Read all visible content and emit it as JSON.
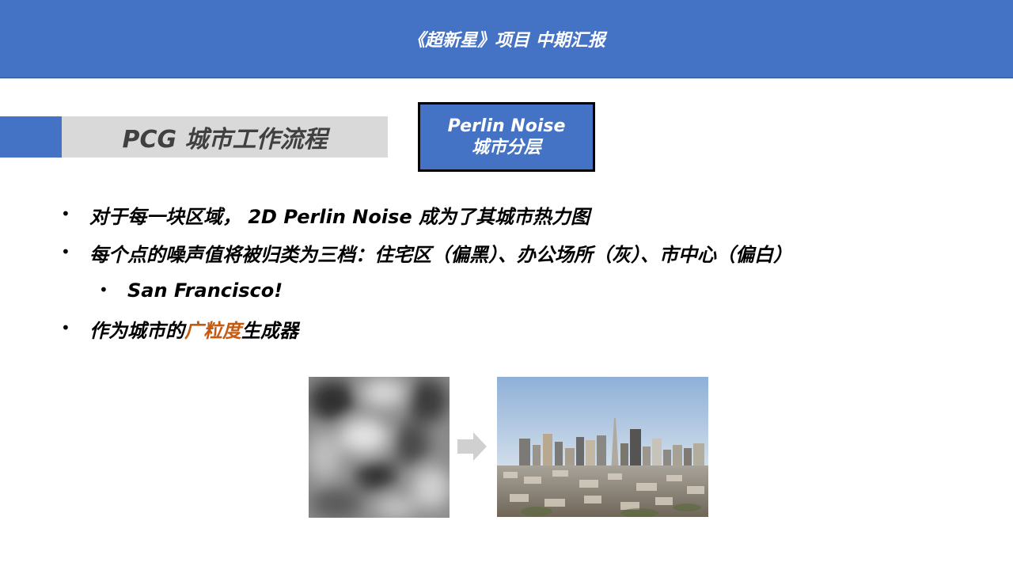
{
  "header": {
    "title": "《超新星》项目 中期汇报"
  },
  "section": {
    "title": "PCG 城市工作流程"
  },
  "badge": {
    "line1": "Perlin Noise",
    "line2": "城市分层"
  },
  "bullets": [
    {
      "text": "对于每一块区域， 2D Perlin Noise 成为了其城市热力图"
    },
    {
      "text": "每个点的噪声值将被归类为三档：住宅区（偏黑）、办公场所（灰）、市中心（偏白）"
    },
    {
      "text": "San Francisco!"
    },
    {
      "prefix": "作为城市的",
      "highlight": "广粒度",
      "suffix": "生成器"
    }
  ],
  "bullet_symbol": "•",
  "colors": {
    "header": "#4472c4",
    "accent": "#4472c4",
    "section_bar": "#d9d9d9",
    "highlight": "#c55a11"
  },
  "images": {
    "noise": "perlin-noise-image",
    "arrow": "arrow-right-icon",
    "city": "san-francisco-skyline-photo"
  }
}
